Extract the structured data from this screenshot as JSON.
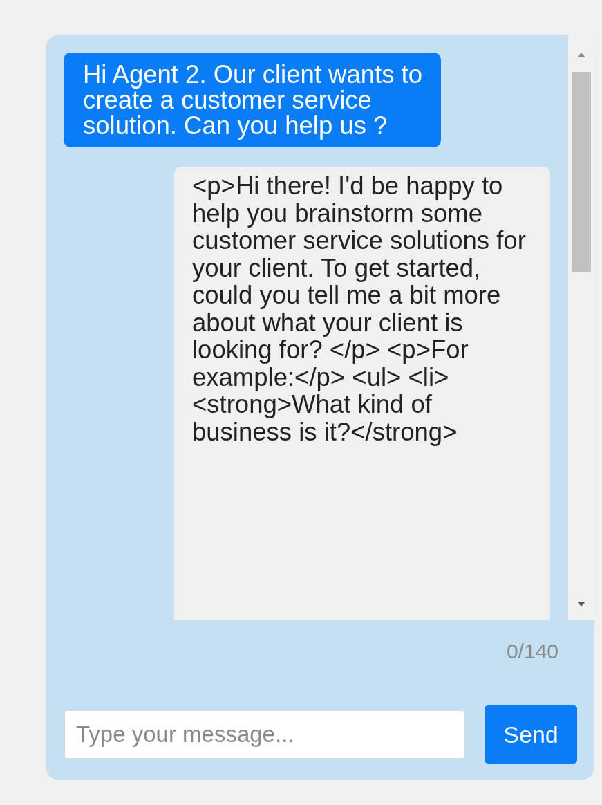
{
  "messages": [
    {
      "kind": "user",
      "text": "Hi Agent 2. Our client wants to create a customer service solution. Can you help us ?"
    },
    {
      "kind": "agent",
      "text": "<p>Hi there! I'd be happy to help you brainstorm some customer service solutions for your client. To get started, could you tell me a bit more about what your client is looking for? </p> <p>For example:</p> <ul> <li> <strong>What kind of business is it?</strong>"
    }
  ],
  "counter": "0/140",
  "input": {
    "placeholder": "Type your message..."
  },
  "send_button": "Send"
}
